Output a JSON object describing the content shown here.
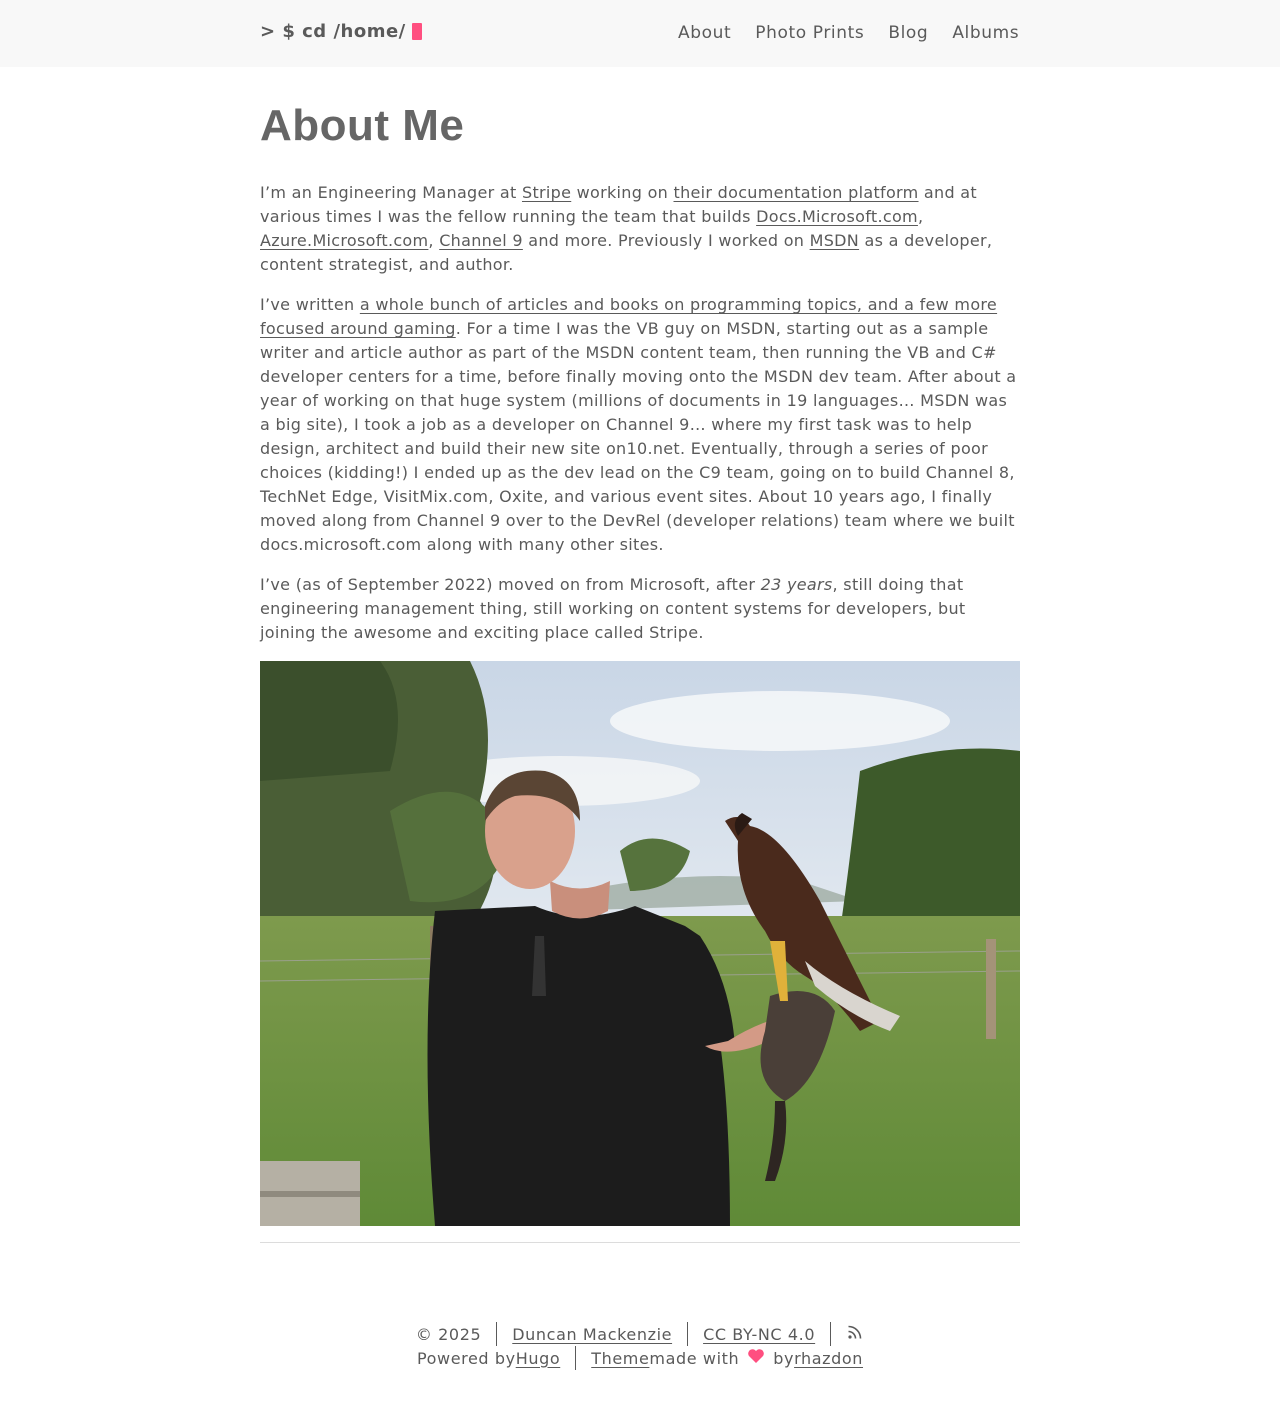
{
  "header": {
    "brand": "> $ cd /home/",
    "nav": [
      "About",
      "Photo Prints",
      "Blog",
      "Albums"
    ]
  },
  "page": {
    "title": "About Me"
  },
  "para1": {
    "t1": "I’m an Engineering Manager at ",
    "stripe": "Stripe",
    "t2": " working on ",
    "docplatform": "their documentation platform",
    "t3": " and at various times I was the fellow running the team that builds ",
    "docs": "Docs.Microsoft.com",
    "comma1": ", ",
    "azure": "Azure.Microsoft.com",
    "comma2": ", ",
    "channel9": "Channel 9",
    "t4": " and more. Previously I worked on ",
    "msdn": "MSDN",
    "t5": " as a developer, content strategist, and author."
  },
  "para2": {
    "t1": "I’ve written ",
    "articles": "a whole bunch of articles and books on programming topics, and a few more focused around gaming",
    "t2": ". For a time I was the VB guy on MSDN, starting out as a sample writer and article author as part of the MSDN content team, then running the VB and C# developer centers for a time, before finally moving onto the MSDN dev team. After about a year of working on that huge system (millions of documents in 19 languages… MSDN was a big site), I took a job as a developer on Channel 9… where my first task was to help design, architect and build their new site on10.net. Eventually, through a series of poor choices (kidding!) I ended up as the dev lead on the C9 team, going on to build Channel 8, TechNet Edge, VisitMix.com, Oxite, and various event sites. About 10 years ago, I finally moved along from Channel 9 over to the DevRel (developer relations) team where we built docs.microsoft.com along with many other sites."
  },
  "para3": {
    "t1": "I’ve (as of September 2022) moved on from Microsoft, after ",
    "em": "23 years",
    "t2": ", still doing that engineering management thing, still working on content systems for developers, but joining the awesome and exciting place called Stripe."
  },
  "footer": {
    "copyright": "© 2025",
    "author": "Duncan Mackenzie",
    "license": "CC BY-NC 4.0",
    "powered": "Powered by ",
    "hugo": "Hugo",
    "theme": "Theme",
    "made_with": " made with",
    "by": "by ",
    "rhazdon": "rhazdon",
    "rss_icon": "rss-icon",
    "heart_icon": "heart-icon"
  },
  "colors": {
    "accent": "#ff4f80",
    "text": "#5a5a5a",
    "header_bg": "#f8f8f8"
  }
}
